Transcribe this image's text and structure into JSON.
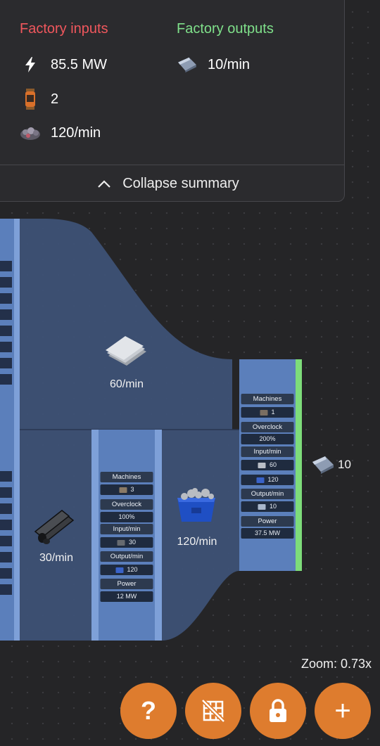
{
  "summary": {
    "inputs_title": "Factory inputs",
    "outputs_title": "Factory outputs",
    "inputs": [
      {
        "icon": "power-icon",
        "value": "85.5 MW"
      },
      {
        "icon": "somersloop-icon",
        "value": "2"
      },
      {
        "icon": "raw-ore-icon",
        "value": "120/min"
      }
    ],
    "outputs": [
      {
        "icon": "plate-item-icon",
        "value": "10/min"
      }
    ],
    "collapse_label": "Collapse summary"
  },
  "flows": {
    "sheet_rate": "60/min",
    "pipe_rate": "30/min",
    "scrap_rate": "120/min",
    "output_rate": "10"
  },
  "node_right": {
    "machines_label": "Machines",
    "machines_count": "1",
    "overclock_label": "Overclock",
    "overclock_value": "200%",
    "input_label": "Input/min",
    "input_1": "60",
    "input_2": "120",
    "output_label": "Output/min",
    "output_1": "10",
    "power_label": "Power",
    "power_value": "37.5 MW"
  },
  "node_mid": {
    "machines_label": "Machines",
    "machines_count": "3",
    "overclock_label": "Overclock",
    "overclock_value": "100%",
    "input_label": "Input/min",
    "input_1": "30",
    "output_label": "Output/min",
    "output_1": "120",
    "power_label": "Power",
    "power_value": "12 MW"
  },
  "zoom_label": "Zoom: 0.73x",
  "fab": {
    "help": "?",
    "grid": "grid-off-icon",
    "lock": "lock-icon",
    "add": "+"
  },
  "colors": {
    "inputs_title": "#f0575d",
    "outputs_title": "#7fe08a",
    "fab": "#de7c2e",
    "node": "#5b7fbb",
    "flow": "#3e5377"
  }
}
